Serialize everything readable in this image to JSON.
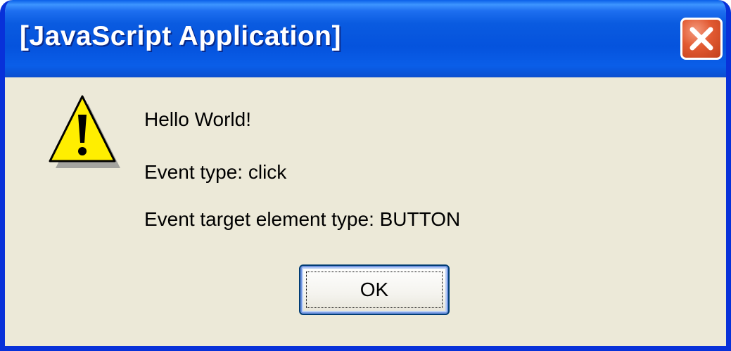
{
  "window": {
    "title": "[JavaScript Application]"
  },
  "dialog": {
    "icon": "warning-icon",
    "message_lines": [
      "Hello World!",
      "Event type: click",
      "Event target element type: BUTTON"
    ],
    "ok_label": "OK"
  },
  "colors": {
    "titlebar": "#0553dd",
    "frame": "#0831d9",
    "body": "#ece9d8",
    "close_button": "#e25a32",
    "warning_yellow": "#ffee00"
  }
}
